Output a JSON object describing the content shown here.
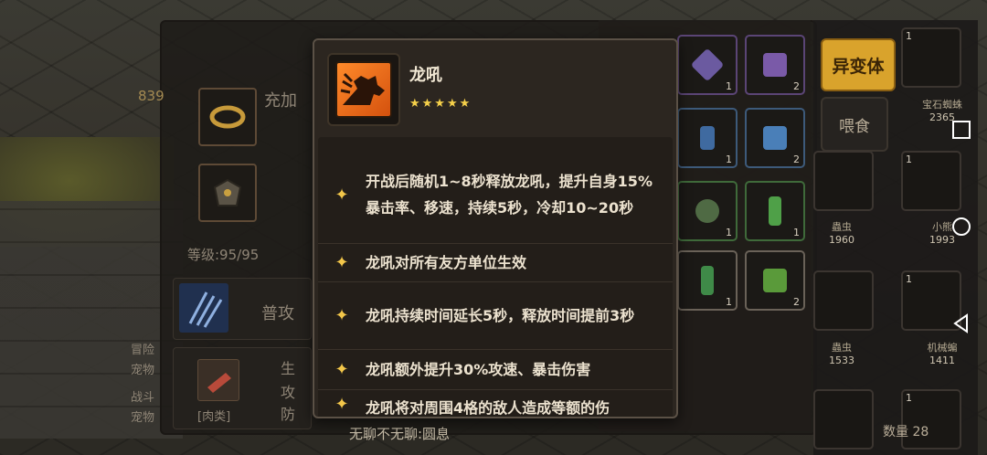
{
  "background": {
    "equipment_level": "等级:95/95",
    "basic_attack_label": "普攻",
    "food_label": "[肉类]",
    "partial_stat_labels": [
      "生",
      "攻",
      "防"
    ],
    "partial_info_labels": [
      "冒险",
      "宠物",
      "战斗",
      "宠物"
    ],
    "power_hint": "839",
    "charge_hint": "充加",
    "bottom_hint": "无聊不无聊:圆息"
  },
  "side": {
    "mutant_button": "异变体",
    "feed_button": "喂食",
    "count_label": "数量 28",
    "pets": [
      {
        "level": "1",
        "name": "宝石蜘蛛",
        "score": "2365"
      },
      {
        "level": "1",
        "name": "蟲虫",
        "score": "1960"
      },
      {
        "level": "1",
        "name": "小熊",
        "score": "1993"
      },
      {
        "level": "1",
        "name": "蟲虫",
        "score": "1533"
      },
      {
        "level": "1",
        "name": "机械蝙",
        "score": "1411"
      },
      {
        "level": "1",
        "name": "",
        "score": ""
      }
    ],
    "inventory_counts": [
      "1",
      "2",
      "1",
      "2",
      "1",
      "1",
      "1",
      "2"
    ]
  },
  "tooltip": {
    "skill_name": "龙吼",
    "stars": "★★★★★",
    "effects": [
      "开战后随机1~8秒释放龙吼，提升自身15%暴击率、移速，持续5秒，冷却10~20秒",
      "龙吼对所有友方单位生效",
      "龙吼持续时间延长5秒，释放时间提前3秒",
      "龙吼额外提升30%攻速、暴击伤害",
      "龙吼将对周围4格的敌人造成等额的伤"
    ]
  },
  "colors": {
    "star": "#f5d04a",
    "mutant_button": "#d9a32c",
    "skill_icon": "#e8691a"
  }
}
